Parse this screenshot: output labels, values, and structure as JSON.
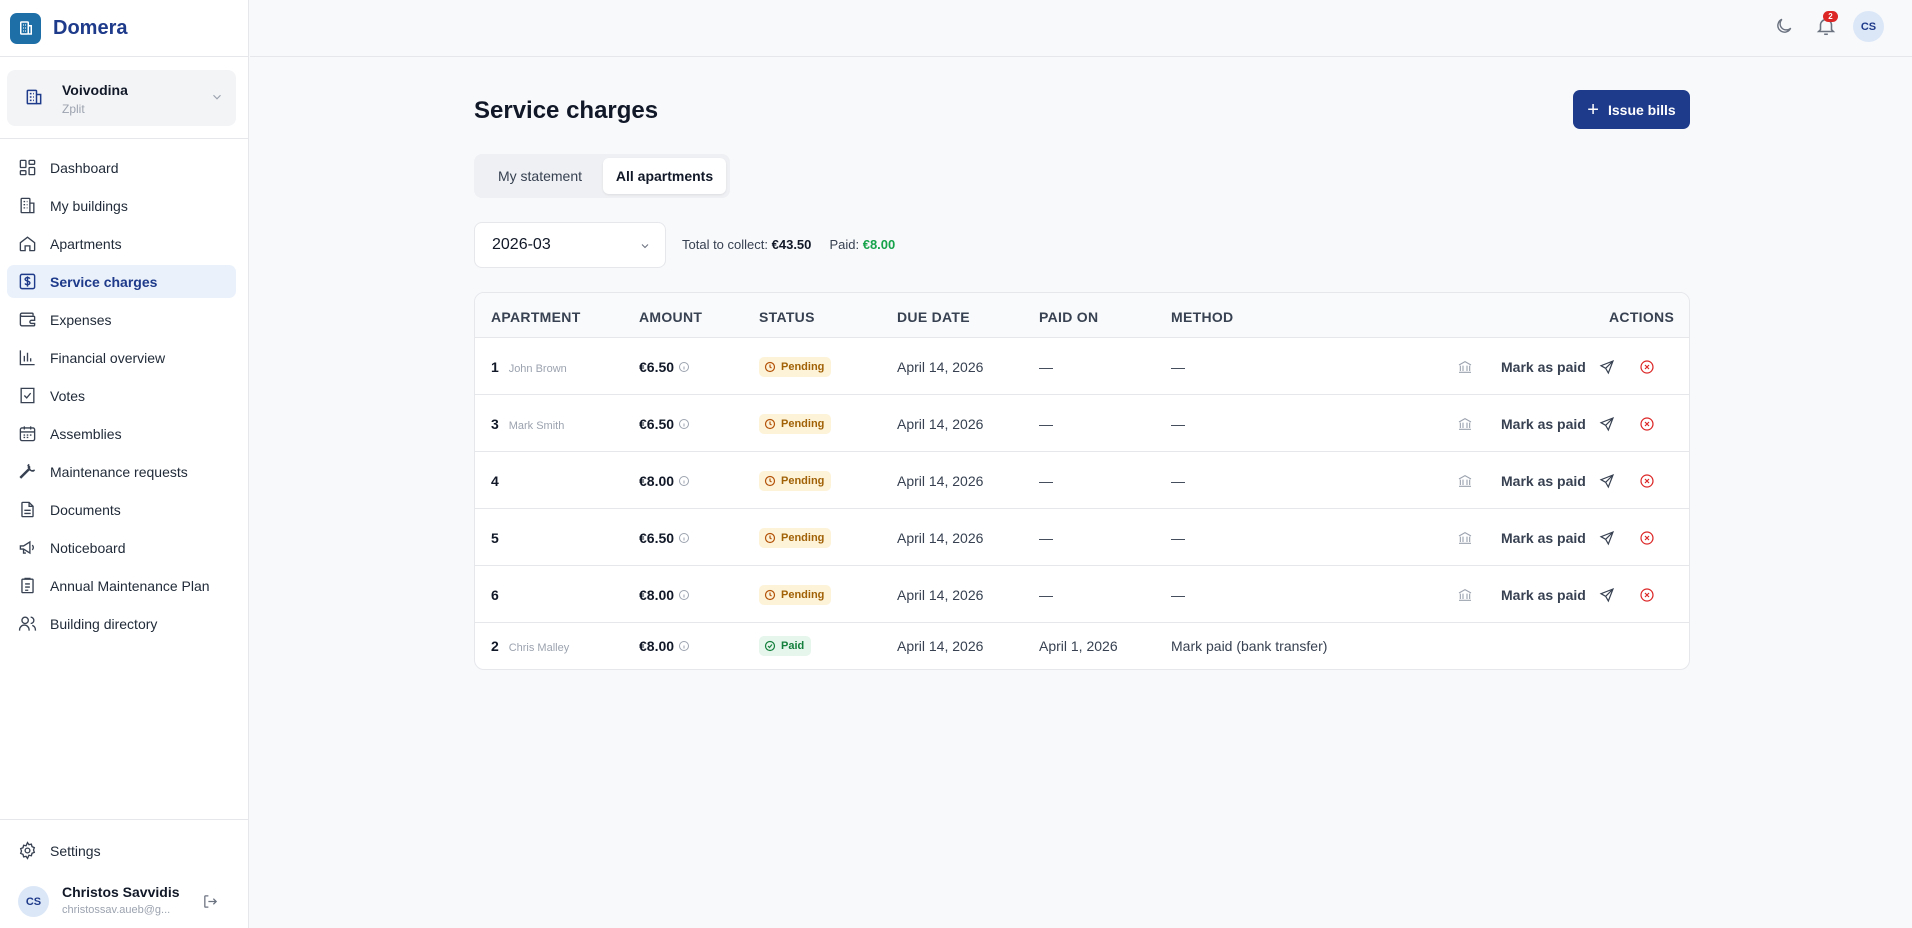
{
  "app": {
    "name": "Domera"
  },
  "building": {
    "name": "Voivodina",
    "subtitle": "Zplit"
  },
  "sidebar": {
    "items": [
      {
        "label": "Dashboard",
        "icon": "grid-icon",
        "active": false
      },
      {
        "label": "My buildings",
        "icon": "buildings-icon",
        "active": false
      },
      {
        "label": "Apartments",
        "icon": "home-icon",
        "active": false
      },
      {
        "label": "Service charges",
        "icon": "dollar-square-icon",
        "active": true
      },
      {
        "label": "Expenses",
        "icon": "wallet-icon",
        "active": false
      },
      {
        "label": "Financial overview",
        "icon": "bar-chart-icon",
        "active": false
      },
      {
        "label": "Votes",
        "icon": "vote-icon",
        "active": false
      },
      {
        "label": "Assemblies",
        "icon": "calendar-icon",
        "active": false
      },
      {
        "label": "Maintenance requests",
        "icon": "wrench-icon",
        "active": false
      },
      {
        "label": "Documents",
        "icon": "document-icon",
        "active": false
      },
      {
        "label": "Noticeboard",
        "icon": "megaphone-icon",
        "active": false
      },
      {
        "label": "Annual Maintenance Plan",
        "icon": "clipboard-icon",
        "active": false
      },
      {
        "label": "Building directory",
        "icon": "users-icon",
        "active": false
      }
    ],
    "settings_label": "Settings"
  },
  "user": {
    "initials": "CS",
    "name": "Christos Savvidis",
    "email": "christossav.aueb@g..."
  },
  "topbar": {
    "notification_count": "2",
    "avatar_initials": "CS"
  },
  "page": {
    "title": "Service charges",
    "issue_button": "Issue bills",
    "tabs": [
      {
        "label": "My statement",
        "active": false
      },
      {
        "label": "All apartments",
        "active": true
      }
    ],
    "period": "2026-03",
    "total_label": "Total to collect:",
    "total_value": "€43.50",
    "paid_label": "Paid:",
    "paid_value": "€8.00"
  },
  "table": {
    "columns": [
      "APARTMENT",
      "AMOUNT",
      "STATUS",
      "DUE DATE",
      "PAID ON",
      "METHOD",
      "ACTIONS"
    ],
    "mark_paid_label": "Mark as paid",
    "rows": [
      {
        "apt": "1",
        "owner": "John Brown",
        "amount": "€6.50",
        "status": "Pending",
        "due": "April 14, 2026",
        "paid_on": "—",
        "method": "—",
        "actions": true
      },
      {
        "apt": "3",
        "owner": "Mark Smith",
        "amount": "€6.50",
        "status": "Pending",
        "due": "April 14, 2026",
        "paid_on": "—",
        "method": "—",
        "actions": true
      },
      {
        "apt": "4",
        "owner": "",
        "amount": "€8.00",
        "status": "Pending",
        "due": "April 14, 2026",
        "paid_on": "—",
        "method": "—",
        "actions": true
      },
      {
        "apt": "5",
        "owner": "",
        "amount": "€6.50",
        "status": "Pending",
        "due": "April 14, 2026",
        "paid_on": "—",
        "method": "—",
        "actions": true
      },
      {
        "apt": "6",
        "owner": "",
        "amount": "€8.00",
        "status": "Pending",
        "due": "April 14, 2026",
        "paid_on": "—",
        "method": "—",
        "actions": true
      },
      {
        "apt": "2",
        "owner": "Chris Malley",
        "amount": "€8.00",
        "status": "Paid",
        "due": "April 14, 2026",
        "paid_on": "April 1, 2026",
        "method": "Mark paid (bank transfer)",
        "actions": false
      }
    ]
  },
  "colors": {
    "brand": "#1e3a8a",
    "accent": "#1e6fa8",
    "pending": "#a16207",
    "paid": "#16a34a",
    "danger": "#dc2626"
  }
}
